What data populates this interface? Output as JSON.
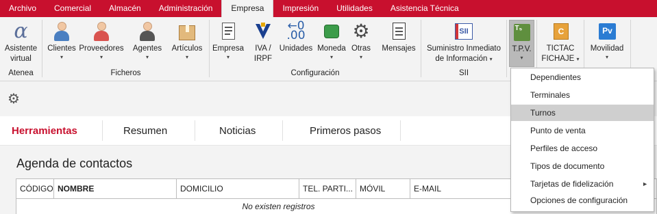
{
  "menu": [
    "Archivo",
    "Comercial",
    "Almacén",
    "Administración",
    "Empresa",
    "Impresión",
    "Utilidades",
    "Asistencia Técnica"
  ],
  "ribbon": {
    "asistente": {
      "line1": "Asistente",
      "line2": "virtual"
    },
    "clientes": "Clientes",
    "proveedores": "Proveedores",
    "agentes": "Agentes",
    "articulos": "Artículos",
    "empresa": "Empresa",
    "iva": {
      "line1": "IVA /",
      "line2": "IRPF"
    },
    "unidades": "Unidades",
    "moneda": "Moneda",
    "otras": "Otras",
    "mensajes": "Mensajes",
    "suministro": {
      "line1": "Suministro Inmediato",
      "line2": "de Información"
    },
    "tpv": "T.P.V.",
    "tictac": {
      "line1": "TICTAC",
      "line2": "FICHAJE"
    },
    "movilidad": "Movilidad",
    "dropdown_glyph": "▾",
    "groups": {
      "atenea": "Atenea",
      "ficheros": "Ficheros",
      "configuracion": "Configuración",
      "sii": "SII"
    },
    "icons": {
      "asistente": "alpha-icon",
      "clientes": "person-icon",
      "proveedores": "person-icon",
      "agentes": "agent-icon",
      "articulos": "box-icon",
      "empresa": "document-icon",
      "iva": "tax-agency-icon",
      "unidades": "units-icon",
      "moneda": "coins-icon",
      "otras": "gear-icon",
      "mensajes": "messages-icon",
      "suministro": "sii-icon",
      "tpv": "tpv-icon",
      "tictac": "tictac-icon",
      "movilidad": "mobility-icon"
    },
    "icon_text": {
      "alpha": "α",
      "units": "←0",
      "units2": ".00",
      "sii": "SII",
      "tpv": "T₅",
      "tictac": "C",
      "pv": "Pv",
      "gear": "⚙"
    }
  },
  "toolbar": {
    "settings_glyph": "⚙"
  },
  "tabs": [
    "Herramientas",
    "Resumen",
    "Noticias",
    "Primeros pasos"
  ],
  "agenda": {
    "title": "Agenda de contactos",
    "columns": [
      "CÓDIGO",
      "NOMBRE",
      "DOMICILIO",
      "TEL. PARTI...",
      "MÓVIL",
      "E-MAIL"
    ],
    "empty_text": "No existen registros"
  },
  "tpv_menu": {
    "items": [
      "Dependientes",
      "Terminales",
      "Turnos",
      "Punto de venta",
      "Perfiles de acceso",
      "Tipos de documento",
      "Tarjetas de fidelización",
      "Opciones de configuración"
    ],
    "highlighted": "Turnos",
    "submenu_glyph": "►"
  },
  "colors": {
    "brand_red": "#c8102e",
    "menu_highlight": "#cfcfcf"
  }
}
